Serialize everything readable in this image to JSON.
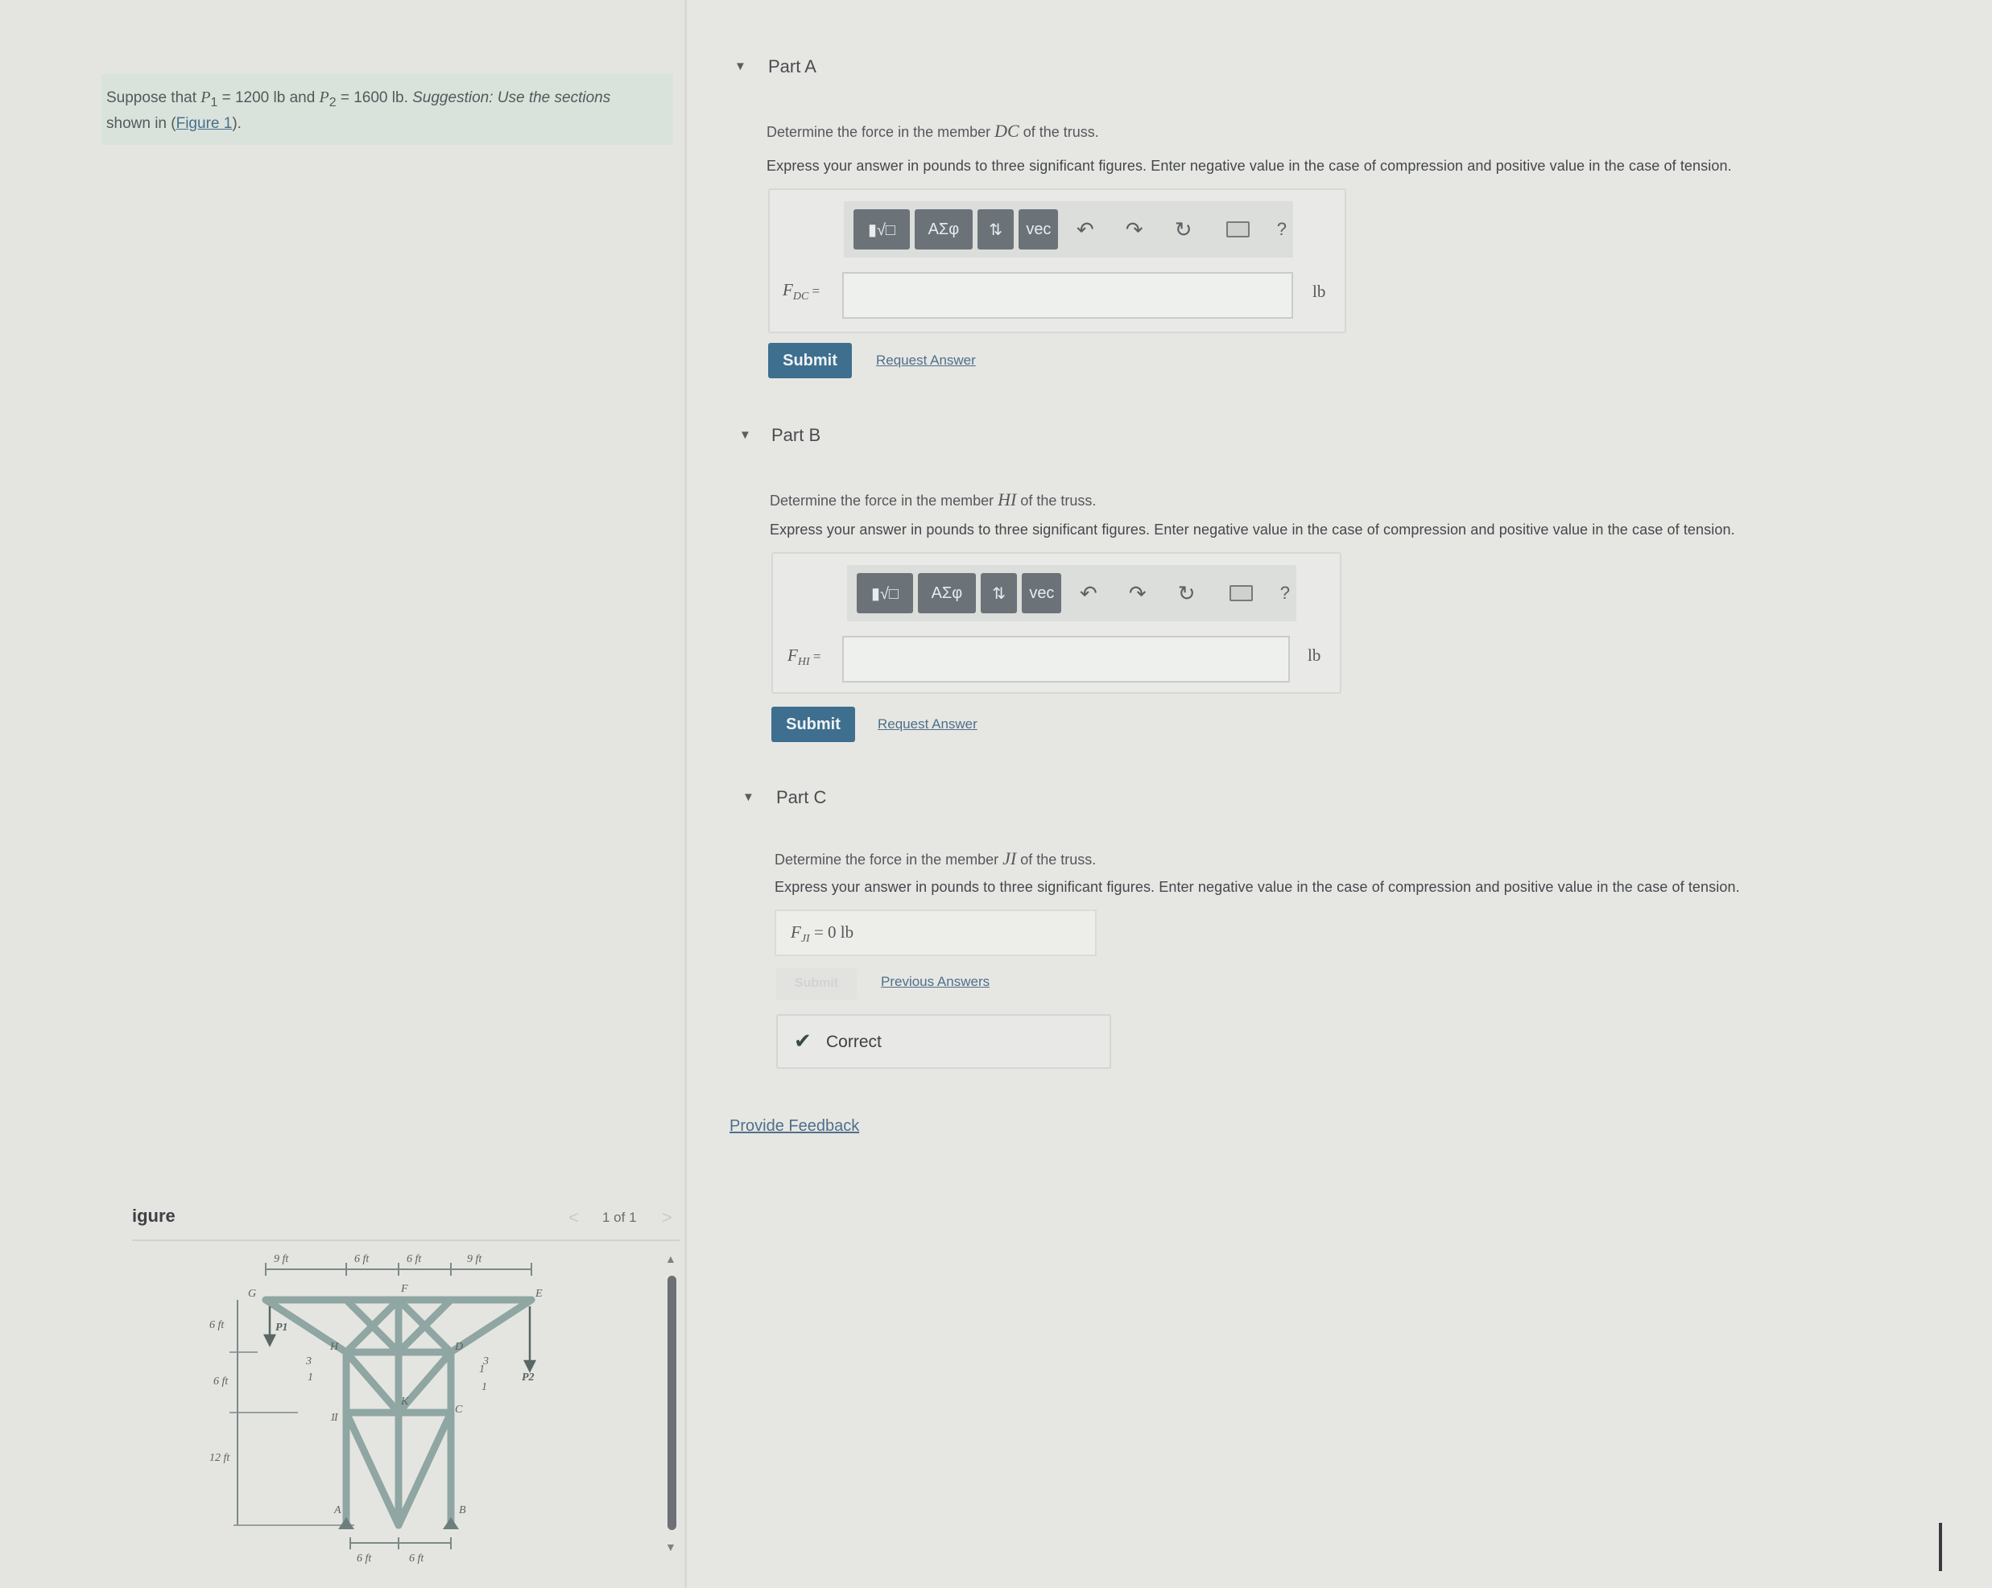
{
  "problem": {
    "text_1": "Suppose that ",
    "p1": "P",
    "p1_sub": "1",
    "text_2": " = 1200 lb and ",
    "p2": "P",
    "p2_sub": "2",
    "text_3": " = 1600 lb. ",
    "suggestion": "Suggestion: Use the sections",
    "text_4": "shown in (",
    "figure_link": "Figure 1",
    "text_5": ")."
  },
  "figure": {
    "title": "igure",
    "pager": "1 of 1",
    "prev": "<",
    "next": ">",
    "scroll_up": "▲",
    "scroll_down": "▼",
    "labels": {
      "top_dims": [
        "9 ft",
        "6 ft",
        "6 ft",
        "9 ft"
      ],
      "bottom_dims": [
        "6 ft",
        "6 ft"
      ],
      "left_dims": [
        "6 ft",
        "6 ft",
        "12 ft"
      ],
      "nodes": [
        "G",
        "F",
        "E",
        "H",
        "D",
        "I",
        "C",
        "K",
        "A",
        "B"
      ],
      "loads": [
        "P1",
        "P2"
      ],
      "sections": [
        "1",
        "1",
        "1",
        "1",
        "3",
        "3"
      ]
    }
  },
  "partA": {
    "caret": "▼",
    "title": "Part A",
    "prompt_pre": "Determine the force in the member ",
    "member": "DC",
    "prompt_post": " of the truss.",
    "instruction": "Express your answer in pounds to three significant figures. Enter negative value in the case of compression and positive value in the case of tension.",
    "toolbar": [
      "▮√□",
      "ΑΣφ",
      "⇅",
      "vec",
      "↶",
      "↷",
      "↻",
      "?"
    ],
    "var_main": "F",
    "var_sub": "DC",
    "equals": " =",
    "value": "",
    "unit": "lb",
    "submit": "Submit",
    "request": "Request Answer"
  },
  "partB": {
    "caret": "▼",
    "title": "Part B",
    "prompt_pre": "Determine the force in the member ",
    "member": "HI",
    "prompt_post": " of the truss.",
    "instruction": "Express your answer in pounds to three significant figures. Enter negative value in the case of compression and positive value in the case of tension.",
    "toolbar": [
      "▮√□",
      "ΑΣφ",
      "⇅",
      "vec",
      "↶",
      "↷",
      "↻",
      "?"
    ],
    "var_main": "F",
    "var_sub": "HI",
    "equals": " =",
    "value": "",
    "unit": "lb",
    "submit": "Submit",
    "request": "Request Answer"
  },
  "partC": {
    "caret": "▼",
    "title": "Part C",
    "prompt_pre": "Determine the force in the member ",
    "member": "JI",
    "prompt_post": " of the truss.",
    "instruction": "Express your answer in pounds to three significant figures. Enter negative value in the case of compression and positive value in the case of tension.",
    "var_main": "F",
    "var_sub": "JI",
    "answer": " = 0 lb",
    "submit": "Submit",
    "previous": "Previous Answers",
    "status": "Correct"
  },
  "feedback": "Provide Feedback"
}
